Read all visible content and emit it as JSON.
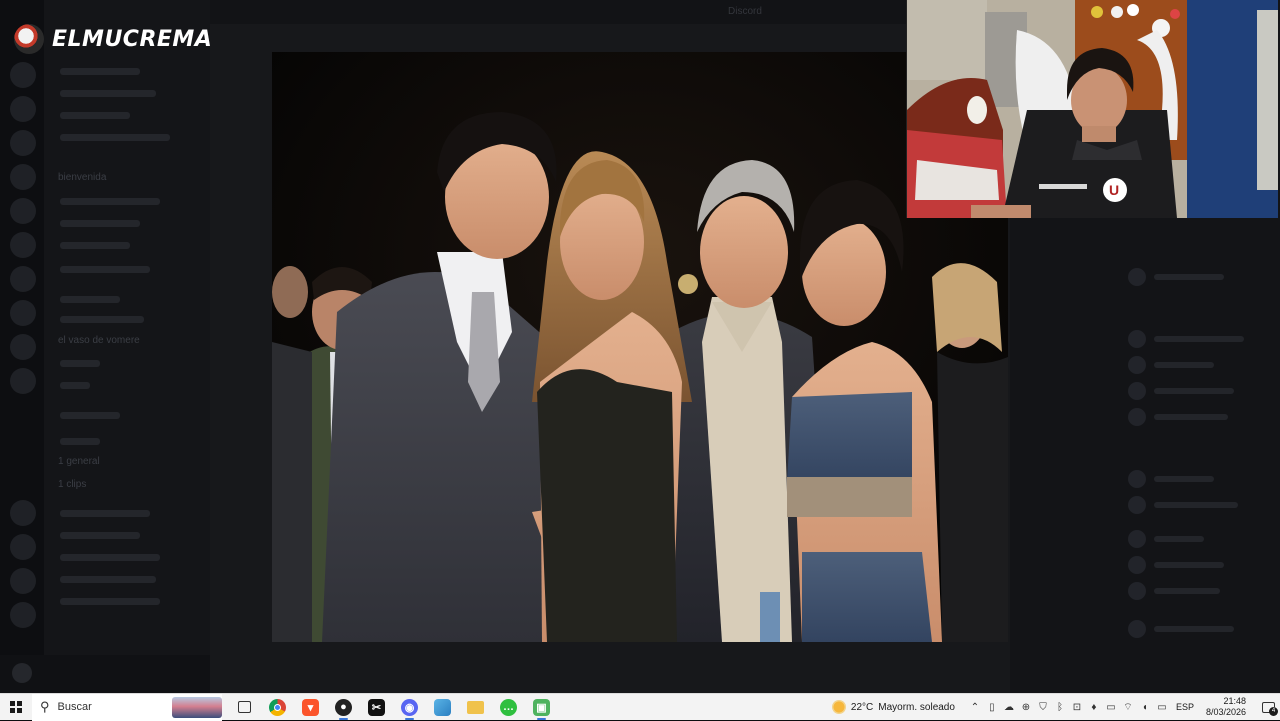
{
  "overlay": {
    "logo_text": "ELMUCREMA"
  },
  "background_app": {
    "window_title": "Discord",
    "channel_categories": [
      "bienvenida",
      "el vaso de vomere",
      "1 general",
      "1 clips"
    ]
  },
  "taskbar": {
    "search_placeholder": "Buscar",
    "apps": [
      {
        "name": "task-view",
        "icon": "task-view-icon",
        "color": "#3a3a3a"
      },
      {
        "name": "chrome",
        "icon": "chrome-icon",
        "color": "#d9473b"
      },
      {
        "name": "brave",
        "icon": "brave-icon",
        "color": "#e5562b"
      },
      {
        "name": "obs",
        "icon": "obs-icon",
        "color": "#2b2b2b"
      },
      {
        "name": "capcut",
        "icon": "capcut-icon",
        "color": "#1b1b1b"
      },
      {
        "name": "discord",
        "icon": "discord-icon",
        "color": "#5865f2"
      },
      {
        "name": "files",
        "icon": "app-icon",
        "color": "#3aa0d8"
      },
      {
        "name": "explorer",
        "icon": "folder-icon",
        "color": "#e8b640"
      },
      {
        "name": "line",
        "icon": "chat-icon",
        "color": "#2fb64a"
      },
      {
        "name": "game",
        "icon": "game-icon",
        "color": "#55b866"
      }
    ],
    "weather": {
      "temp": "22°C",
      "condition": "Mayorm. soleado"
    },
    "language": "ESP",
    "time": "21:48",
    "date": "8/03/2026",
    "notifications": "4"
  }
}
